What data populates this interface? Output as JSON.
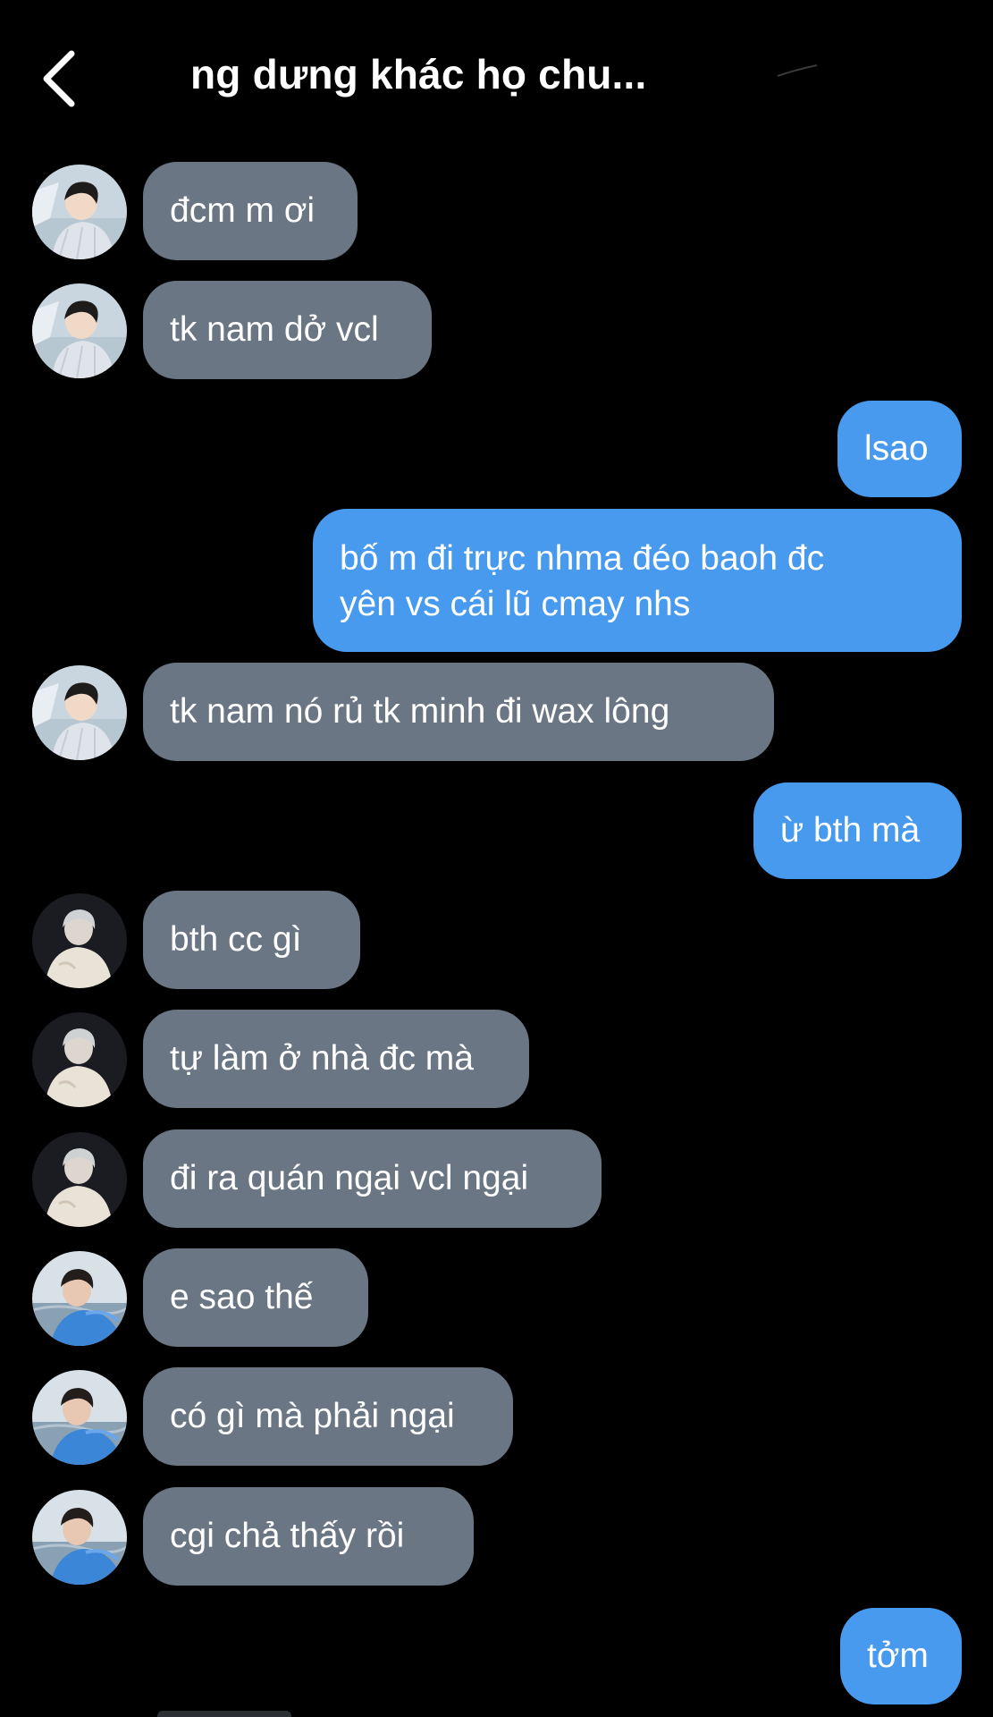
{
  "header": {
    "title": "ng dưng khác họ chu..."
  },
  "messages": [
    {
      "side": "in",
      "avatar": "a",
      "text": "đcm m ơi"
    },
    {
      "side": "in",
      "avatar": "a",
      "text": "tk nam dở vcl"
    },
    {
      "side": "out",
      "text": "lsao"
    },
    {
      "side": "out",
      "text": "bố m đi trực nhma đéo baoh đc yên vs cái lũ cmay nhs",
      "lines": [
        "bố m đi trực nhma đéo baoh đc",
        "yên vs cái lũ cmay nhs"
      ]
    },
    {
      "side": "in",
      "avatar": "a",
      "text": "tk nam nó rủ tk minh đi wax lông"
    },
    {
      "side": "out",
      "text": "ừ bth mà"
    },
    {
      "side": "in",
      "avatar": "b",
      "text": "bth cc gì"
    },
    {
      "side": "in",
      "avatar": "b",
      "text": "tự làm ở nhà đc mà"
    },
    {
      "side": "in",
      "avatar": "b",
      "text": "đi ra quán ngại vcl ngại"
    },
    {
      "side": "in",
      "avatar": "c",
      "text": "e sao thế"
    },
    {
      "side": "in",
      "avatar": "c",
      "text": "có gì mà phải ngại"
    },
    {
      "side": "in",
      "avatar": "c",
      "text": "cgi chả thấy rồi"
    },
    {
      "side": "out",
      "text": "tởm"
    }
  ],
  "colors": {
    "background": "#000000",
    "incoming_bubble": "#6a7683",
    "outgoing_bubble": "#479aee"
  },
  "icons": {
    "back": "chevron-left-icon"
  }
}
